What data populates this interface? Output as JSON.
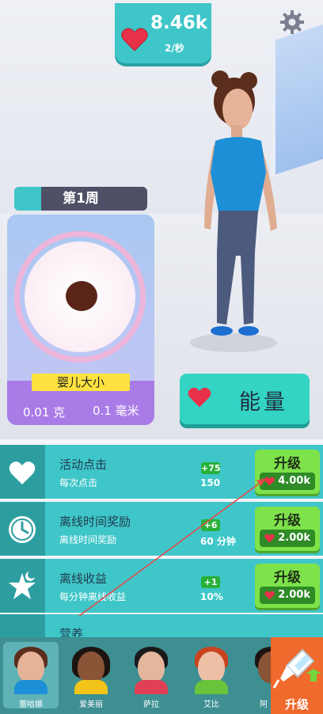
{
  "colors": {
    "accent": "#3fc6c9",
    "heart": "#e8324a",
    "upgrade_green": "#7ee24a",
    "orange_tab": "#ef6a2c"
  },
  "header": {
    "hearts_value": "8.46k",
    "hearts_rate": "2/秒",
    "icon_heart": "heart-icon",
    "icon_settings": "gear-icon"
  },
  "week": {
    "label": "第1周",
    "progress": 0.2
  },
  "baby": {
    "ruler_label": "婴儿大小",
    "weight": "0.01 克",
    "length": "0.1 毫米"
  },
  "energy_button": {
    "label": "能量"
  },
  "upgrades": [
    {
      "title": "活动点击",
      "subtitle": "每次点击",
      "plus": "+75",
      "value": "150",
      "button": "升级",
      "cost": "4.00k",
      "icon": "heart-icon"
    },
    {
      "title": "离线时间奖励",
      "subtitle": "离线时间奖励",
      "plus": "+6",
      "value": "60 分钟",
      "button": "升级",
      "cost": "2.00k",
      "icon": "clock-icon"
    },
    {
      "title": "离线收益",
      "subtitle": "每分钟离线收益",
      "plus": "+1",
      "value": "10%",
      "button": "升级",
      "cost": "2.00k",
      "icon": "star-moon-icon"
    }
  ],
  "partial_row": {
    "title": "营养"
  },
  "characters": [
    {
      "name": "蕾哈娜",
      "selected": true
    },
    {
      "name": "爱美丽",
      "selected": false
    },
    {
      "name": "萨拉",
      "selected": false
    },
    {
      "name": "艾比",
      "selected": false
    },
    {
      "name": "阿",
      "selected": false
    }
  ],
  "upgrade_tab": {
    "label": "升级",
    "icon": "syringe-icon"
  }
}
